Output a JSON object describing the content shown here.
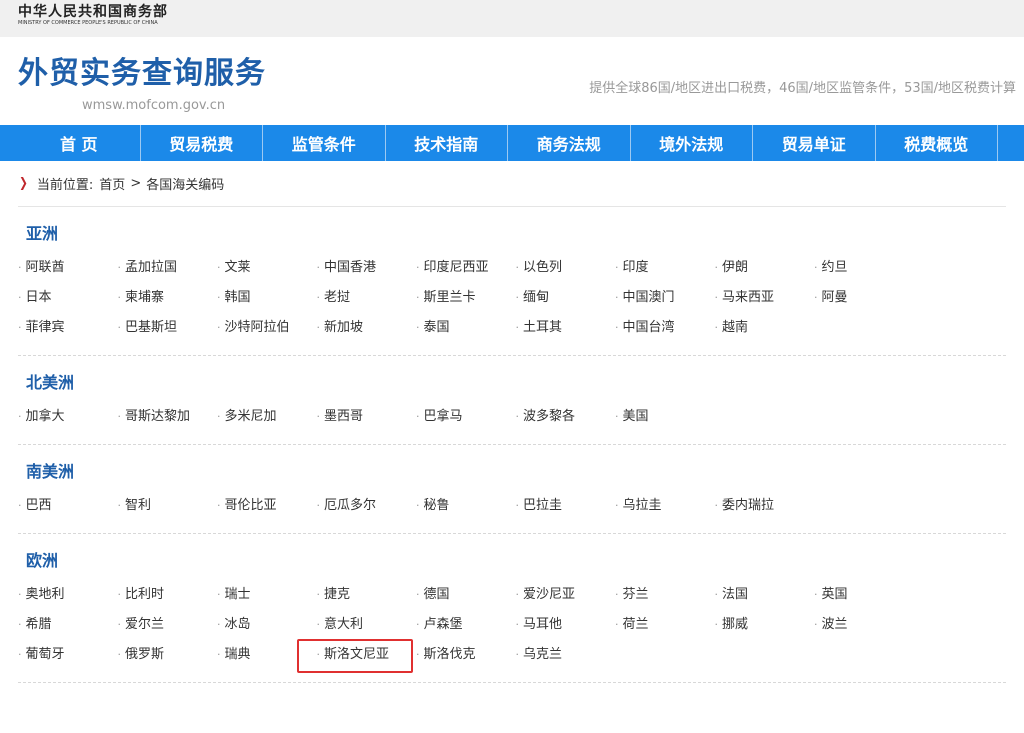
{
  "topbar": {
    "ministry_cn": "中华人民共和国商务部",
    "ministry_en": "MINISTRY OF COMMERCE PEOPLE'S REPUBLIC OF CHINA"
  },
  "header": {
    "title": "外贸实务查询服务",
    "url": "wmsw.mofcom.gov.cn",
    "tagline": "提供全球86国/地区进出口税费，46国/地区监管条件，53国/地区税费计算"
  },
  "nav": {
    "items": [
      "首 页",
      "贸易税费",
      "监管条件",
      "技术指南",
      "商务法规",
      "境外法规",
      "贸易单证",
      "税费概览"
    ]
  },
  "breadcrumb": {
    "label": "当前位置:",
    "home": "首页",
    "separator": ">",
    "current": "各国海关编码"
  },
  "regions": [
    {
      "name": "亚洲",
      "countries": [
        "阿联酋",
        "孟加拉国",
        "文莱",
        "中国香港",
        "印度尼西亚",
        "以色列",
        "印度",
        "伊朗",
        "约旦",
        "日本",
        "柬埔寨",
        "韩国",
        "老挝",
        "斯里兰卡",
        "缅甸",
        "中国澳门",
        "马来西亚",
        "阿曼",
        "菲律宾",
        "巴基斯坦",
        "沙特阿拉伯",
        "新加坡",
        "泰国",
        "土耳其",
        "中国台湾",
        "越南"
      ]
    },
    {
      "name": "北美洲",
      "countries": [
        "加拿大",
        "哥斯达黎加",
        "多米尼加",
        "墨西哥",
        "巴拿马",
        "波多黎各",
        "美国"
      ]
    },
    {
      "name": "南美洲",
      "countries": [
        "巴西",
        "智利",
        "哥伦比亚",
        "厄瓜多尔",
        "秘鲁",
        "巴拉圭",
        "乌拉圭",
        "委内瑞拉"
      ]
    },
    {
      "name": "欧洲",
      "countries": [
        "奥地利",
        "比利时",
        "瑞士",
        "捷克",
        "德国",
        "爱沙尼亚",
        "芬兰",
        "法国",
        "英国",
        "希腊",
        "爱尔兰",
        "冰岛",
        "意大利",
        "卢森堡",
        "马耳他",
        "荷兰",
        "挪威",
        "波兰",
        "葡萄牙",
        "俄罗斯",
        "瑞典",
        "斯洛文尼亚",
        "斯洛伐克",
        "乌克兰"
      ],
      "highlighted": "斯洛文尼亚"
    }
  ],
  "colors": {
    "nav_bg": "#1b89e9",
    "title_blue": "#1f5fa9",
    "highlight_border": "#e03030"
  }
}
